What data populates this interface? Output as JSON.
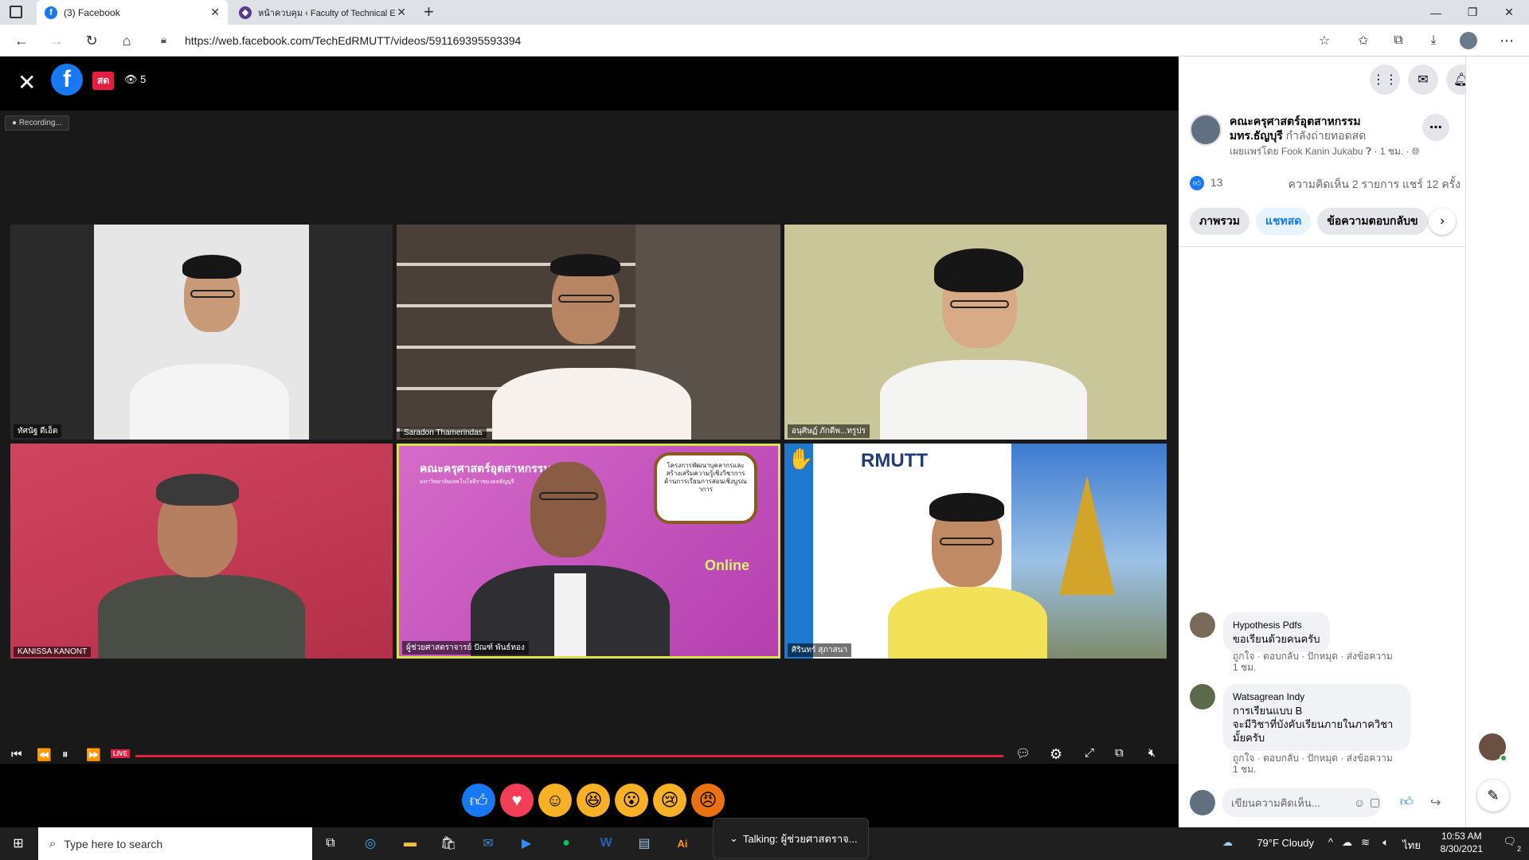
{
  "browser": {
    "tabs": [
      {
        "label": "(3) Facebook",
        "active": true
      },
      {
        "label": "หน้าควบคุม ‹ Faculty of Technical E",
        "active": false
      }
    ],
    "url": "https://web.facebook.com/TechEdRMUTT/videos/591169395593394",
    "new_tab": "+"
  },
  "video": {
    "live_badge": "สด",
    "viewer_count": "5",
    "recording_label": "Recording...",
    "live_tag": "LIVE",
    "participants": [
      {
        "name": "ทัศนัฐ ดีเอ็ด"
      },
      {
        "name": "Saradon Thamerindas"
      },
      {
        "name": "อนุศิษฏ์ ภักดีพ...ทรูปร"
      },
      {
        "name": "KANISSA KANONT"
      },
      {
        "name": "ผู้ช่วยศาสตราจารย์ ปัณฑ์ พันธ์ทอง"
      },
      {
        "name": "ศิรินทร์ สุภาสนา"
      }
    ],
    "tile5_slide": {
      "title": "คณะครุศาสตร์อุตสาหกรรม",
      "subtitle": "มหาวิทยาลัยเทคโนโลยีราชมงคลธัญบุรี",
      "bubble": "โครงการพัฒนาบุคลากรและสร้างเสริมความรู้เชิงวิชาการ ด้านการเรียนการสอนเชิงบูรณาการ",
      "online": "Online"
    },
    "tile6_logo": "RMUTT",
    "reactions": [
      "like",
      "love",
      "care",
      "haha",
      "wow",
      "sad",
      "angry"
    ]
  },
  "facebook_top": {
    "notifications": "3"
  },
  "post": {
    "page_name": "คณะครุศาสตร์อุตสาหกรรม มทร.ธัญบุรี",
    "status": "กำลังถ่ายทอดสด",
    "published_by": "เผยแพร่โดย Fook Kanin Jukabu",
    "time": "1 ชม.",
    "likes": "13",
    "comments_shares": "ความคิดเห็น 2 รายการ  แชร์ 12 ครั้ง",
    "tabs": [
      "ภาพรวม",
      "แชทสด",
      "ข้อความตอบกลับข"
    ],
    "selected_tab": 1
  },
  "comments": [
    {
      "author": "Hypothesis Pdfs",
      "text": "ขอเรียนด้วยคนครับ",
      "actions": "ถูกใจ · ตอบกลับ · ปักหมุด · ส่งข้อความ",
      "time": "1 ชม."
    },
    {
      "author": "Watsagrean Indy",
      "text_lines": [
        "การเรียนแบบ B",
        "จะมีวิชาที่บังคับเรียนภายในภาควิชา",
        "มั้ยครับ"
      ],
      "actions": "ถูกใจ · ตอบกลับ · ปักหมุด · ส่งข้อความ",
      "time": "1 ชม."
    }
  ],
  "composer": {
    "placeholder": "เขียนความคิดเห็น..."
  },
  "taskbar": {
    "search_placeholder": "Type here to search",
    "talking": "Talking: ผู้ช่วยศาสตราจ...",
    "weather": "79°F  Cloudy",
    "lang": "ไทย",
    "time": "10:53 AM",
    "date": "8/30/2021",
    "notif_count": "2"
  }
}
